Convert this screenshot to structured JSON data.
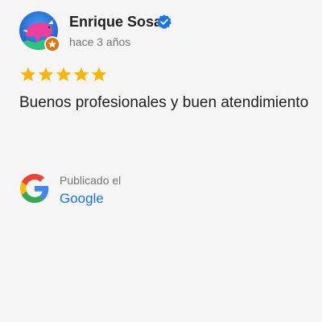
{
  "review": {
    "author_name": "Enrique Sosa",
    "time_ago": "hace 3 años",
    "rating": 5,
    "rating_max": 5,
    "text": "Buenos profesionales y buen atendimiento"
  },
  "source": {
    "posted_label": "Publicado el",
    "platform_name": "Google"
  },
  "icons": {
    "verified": "verified-badge-icon",
    "local_guide": "local-guide-badge-icon",
    "star": "star-icon",
    "platform_logo": "google-logo-icon"
  },
  "colors": {
    "star": "#f7b603",
    "verified": "#1a73e8",
    "link": "#1a73e8",
    "muted_text": "#70757a",
    "local_guide_badge": "#e8710a"
  }
}
